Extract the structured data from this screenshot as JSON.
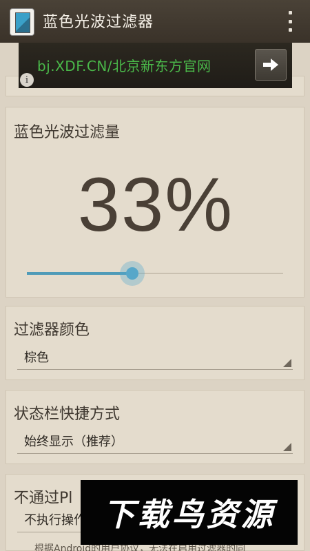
{
  "actionbar": {
    "title": "蓝色光波过滤器",
    "app_icon": "app-phone-icon",
    "overflow_icon": "overflow-menu-icon"
  },
  "ad": {
    "text": "bj.XDF.CN/北京新东方官网",
    "arrow_icon": "arrow-right-icon",
    "info_icon": "info-icon",
    "info_glyph": "i",
    "text_color": "#4ab94a"
  },
  "filter_amount": {
    "title": "蓝色光波过滤量",
    "value_text": "33%",
    "slider_fraction": 0.41,
    "accent_color": "#57a7c9"
  },
  "filter_color": {
    "title": "过滤器颜色",
    "selected": "棕色"
  },
  "statusbar_shortcut": {
    "title": "状态栏快捷方式",
    "selected": "始终显示（推荐）"
  },
  "play_option": {
    "title": "不通过Pl",
    "selected": "不执行操作",
    "notice": "根据Android的用户协议，无法在启用过滤器的同"
  },
  "watermark": {
    "text": "下载鸟资源"
  }
}
